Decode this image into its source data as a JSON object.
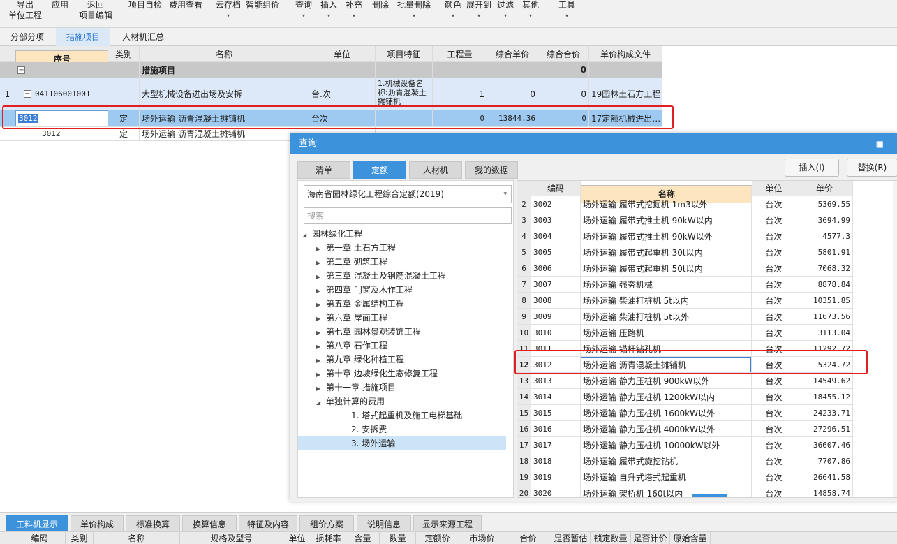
{
  "toolbar": {
    "export_l1": "导出",
    "export_l2": "单位工程",
    "apply": "应用",
    "back_l1": "返回",
    "back_l2": "项目编辑",
    "selfcheck": "项目自检",
    "feeview": "费用查看",
    "cloud": "云存档",
    "smart": "智能组价",
    "query": "查询",
    "insert": "插入",
    "supplement": "补充",
    "delete": "删除",
    "batchdelete": "批量删除",
    "color": "颜色",
    "expand": "展开到",
    "filter": "过滤",
    "other": "其他",
    "tools": "工具"
  },
  "tabs": [
    "分部分项",
    "措施项目",
    "人材机汇总"
  ],
  "grid": {
    "headers": [
      "序号",
      "类别",
      "名称",
      "单位",
      "项目特征",
      "工程量",
      "综合单价",
      "综合合价",
      "单价构成文件"
    ],
    "group": {
      "name": "措施项目",
      "total": "0"
    },
    "row1": {
      "idx": "1",
      "code": "041106001001",
      "name": "大型机械设备进出场及安拆",
      "unit": "台.次",
      "feature": "1.机械设备名称:沥青混凝土摊铺机",
      "qty": "1",
      "price": "0",
      "total": "0",
      "file": "19园林土石方工程"
    },
    "row2": {
      "code": "3012",
      "type": "定",
      "name": "场外运输 沥青混凝土摊铺机",
      "unit": "台次",
      "qty": "0",
      "price": "13844.36",
      "total": "0",
      "file": "17定额机械进出…"
    },
    "row3": {
      "code": "3012",
      "type": "定",
      "name": "场外运输 沥青混凝土摊铺机"
    }
  },
  "dialog": {
    "title": "查询",
    "tabs": [
      "清单",
      "定额",
      "人材机",
      "我的数据"
    ],
    "insert_btn": "插入(I)",
    "replace_btn": "替换(R)",
    "library": "海南省园林绿化工程综合定额(2019)",
    "search_placeholder": "搜索",
    "tree": [
      {
        "label": "园林绿化工程",
        "level": 0,
        "toggle": "◢"
      },
      {
        "label": "第一章 土石方工程",
        "level": 1,
        "toggle": "▶"
      },
      {
        "label": "第二章 砌筑工程",
        "level": 1,
        "toggle": "▶"
      },
      {
        "label": "第三章 混凝土及钢筋混凝土工程",
        "level": 1,
        "toggle": "▶"
      },
      {
        "label": "第四章 门窗及木作工程",
        "level": 1,
        "toggle": "▶"
      },
      {
        "label": "第五章 金属结构工程",
        "level": 1,
        "toggle": "▶"
      },
      {
        "label": "第六章 屋面工程",
        "level": 1,
        "toggle": "▶"
      },
      {
        "label": "第七章 园林景观装饰工程",
        "level": 1,
        "toggle": "▶"
      },
      {
        "label": "第八章 石作工程",
        "level": 1,
        "toggle": "▶"
      },
      {
        "label": "第九章 绿化种植工程",
        "level": 1,
        "toggle": "▶"
      },
      {
        "label": "第十章 边坡绿化生态修复工程",
        "level": 1,
        "toggle": "▶"
      },
      {
        "label": "第十一章 措施项目",
        "level": 1,
        "toggle": "▶"
      },
      {
        "label": "单独计算的费用",
        "level": 1,
        "toggle": "◢"
      },
      {
        "label": "1. 塔式起重机及施工电梯基础",
        "level": 2,
        "toggle": ""
      },
      {
        "label": "2. 安拆费",
        "level": 2,
        "toggle": ""
      },
      {
        "label": "3. 场外运输",
        "level": 2,
        "toggle": ""
      }
    ],
    "table_headers": [
      "",
      "编码",
      "名称",
      "单位",
      "单价"
    ],
    "rows": [
      {
        "n": "2",
        "code": "3002",
        "name": "场外运输 履带式挖掘机 1m3以外",
        "unit": "台次",
        "price": "5369.55"
      },
      {
        "n": "3",
        "code": "3003",
        "name": "场外运输 履带式推土机 90kW以内",
        "unit": "台次",
        "price": "3694.99"
      },
      {
        "n": "4",
        "code": "3004",
        "name": "场外运输 履带式推土机 90kW以外",
        "unit": "台次",
        "price": "4577.3"
      },
      {
        "n": "5",
        "code": "3005",
        "name": "场外运输 履带式起重机 30t以内",
        "unit": "台次",
        "price": "5801.91"
      },
      {
        "n": "6",
        "code": "3006",
        "name": "场外运输 履带式起重机 50t以内",
        "unit": "台次",
        "price": "7068.32"
      },
      {
        "n": "7",
        "code": "3007",
        "name": "场外运输 强夯机械",
        "unit": "台次",
        "price": "8878.84"
      },
      {
        "n": "8",
        "code": "3008",
        "name": "场外运输 柴油打桩机 5t以内",
        "unit": "台次",
        "price": "10351.85"
      },
      {
        "n": "9",
        "code": "3009",
        "name": "场外运输 柴油打桩机 5t以外",
        "unit": "台次",
        "price": "11673.56"
      },
      {
        "n": "10",
        "code": "3010",
        "name": "场外运输 压路机",
        "unit": "台次",
        "price": "3113.04"
      },
      {
        "n": "11",
        "code": "3011",
        "name": "场外运输 锚杆钻孔机",
        "unit": "台次",
        "price": "11292.72"
      },
      {
        "n": "12",
        "code": "3012",
        "name": "场外运输 沥青混凝土摊铺机",
        "unit": "台次",
        "price": "5324.72"
      },
      {
        "n": "13",
        "code": "3013",
        "name": "场外运输 静力压桩机 900kW以外",
        "unit": "台次",
        "price": "14549.62"
      },
      {
        "n": "14",
        "code": "3014",
        "name": "场外运输 静力压桩机 1200kW以内",
        "unit": "台次",
        "price": "18455.12"
      },
      {
        "n": "15",
        "code": "3015",
        "name": "场外运输 静力压桩机 1600kW以外",
        "unit": "台次",
        "price": "24233.71"
      },
      {
        "n": "16",
        "code": "3016",
        "name": "场外运输 静力压桩机 4000kW以外",
        "unit": "台次",
        "price": "27296.51"
      },
      {
        "n": "17",
        "code": "3017",
        "name": "场外运输 静力压桩机 10000kW以外",
        "unit": "台次",
        "price": "36607.46"
      },
      {
        "n": "18",
        "code": "3018",
        "name": "场外运输 履带式旋挖钻机",
        "unit": "台次",
        "price": "7707.86"
      },
      {
        "n": "19",
        "code": "3019",
        "name": "场外运输 自升式塔式起重机",
        "unit": "台次",
        "price": "26641.58"
      },
      {
        "n": "20",
        "code": "3020",
        "name": "场外运输 架桥机 160t以内",
        "unit": "台次",
        "price": "14858.74"
      }
    ]
  },
  "bottom": {
    "tabs": [
      "工料机显示",
      "单价构成",
      "标准换算",
      "换算信息",
      "特征及内容",
      "组价方案",
      "说明信息",
      "显示来源工程"
    ],
    "headers": [
      "编码",
      "类别",
      "名称",
      "规格及型号",
      "单位",
      "损耗率",
      "含量",
      "数量",
      "定额价",
      "市场价",
      "合价",
      "是否暂估",
      "锁定数量",
      "是否计价",
      "原始含量"
    ]
  },
  "colors": {
    "accent": "#3d92dc",
    "highlight": "#e02020",
    "selected_row": "#9ec9f0",
    "group_row": "#c8c8c8"
  }
}
